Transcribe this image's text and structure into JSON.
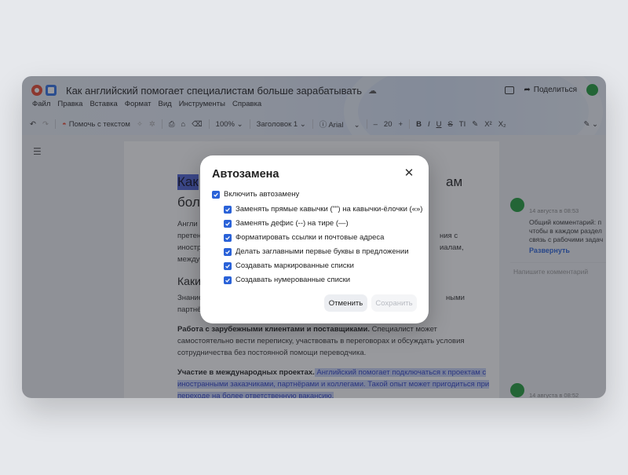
{
  "window": {
    "title": "Как английский помогает специалистам больше зарабатывать",
    "share_label": "Поделиться"
  },
  "menu": [
    "Файл",
    "Правка",
    "Вставка",
    "Формат",
    "Вид",
    "Инструменты",
    "Справка"
  ],
  "toolbar": {
    "help_label": "Помочь с текстом",
    "zoom": "100%",
    "style": "Заголовок 1",
    "font": "Arial",
    "minus": "–",
    "font_size": "20",
    "plus": "+",
    "bold": "B",
    "italic": "I",
    "underline": "U",
    "strike": "S",
    "caps": "TI",
    "superscript": "X²",
    "subscript": "X₂"
  },
  "document": {
    "heading_fragment": "Как",
    "heading_end": "ам",
    "heading_line2": "бол",
    "para1_lines": [
      "Англи",
      "претен",
      "иностр",
      "между"
    ],
    "para1_right": [
      "ния с",
      "иалам,"
    ],
    "subheading": "Каки",
    "para2_lines": [
      "Знание",
      "партнё"
    ],
    "para2_right": "ными",
    "para3_bold": "Работа с зарубежными клиентами и поставщиками.",
    "para3_text_a": " Специалист может",
    "para3_text_b": "самостоятельно вести переписку, участвовать в переговорах и обсуждать условия",
    "para3_text_c": "сотрудничества без постоянной помощи переводчика.",
    "para4_bold": "Участие в международных проектах.",
    "para4_hl_a": " Английский помогает подключаться к проектам с",
    "para4_hl_b": "иностранными заказчиками, партнёрами и коллегами. Такой опыт может пригодиться при",
    "para4_hl_c": "переходе на более ответственную вакансию."
  },
  "comments": {
    "first": {
      "date": "14 августа в 08:53",
      "lines": [
        "Общий комментарий: п",
        "чтобы в каждом раздел",
        "связь с рабочими задач"
      ],
      "expand_label": "Развернуть"
    },
    "input_placeholder": "Напишите комментарий",
    "second": {
      "date": "14 августа в 08:52"
    }
  },
  "dialog": {
    "title": "Автозамена",
    "options": [
      {
        "label": "Включить автозамену",
        "checked": true
      },
      {
        "label": "Заменять прямые кавычки (\"\") на кавычки-ёлочки («»)",
        "checked": true
      },
      {
        "label": "Заменять дефис (--) на тире (—)",
        "checked": true
      },
      {
        "label": "Форматировать ссылки и почтовые адреса",
        "checked": true
      },
      {
        "label": "Делать заглавными первые буквы в предложении",
        "checked": true
      },
      {
        "label": "Создавать маркированные списки",
        "checked": true
      },
      {
        "label": "Создавать нумерованные списки",
        "checked": true
      }
    ],
    "cancel_label": "Отменить",
    "save_label": "Сохранить"
  },
  "colors": {
    "accent": "#2a62d8",
    "avatar": "#1f9c3a",
    "selection": "#4e63d6"
  },
  "icons": [
    "undo-icon",
    "redo-icon",
    "print-icon",
    "format-paint-icon",
    "eraser-icon",
    "outline-icon",
    "comment-icon",
    "share-icon",
    "close-icon",
    "checkbox-icon"
  ]
}
